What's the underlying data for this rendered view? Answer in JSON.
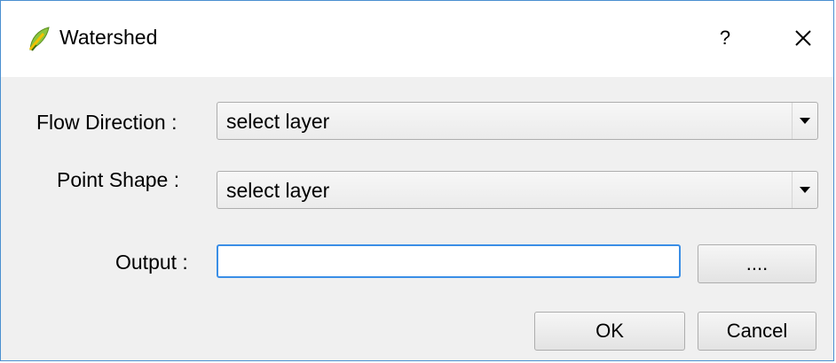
{
  "window": {
    "title": "Watershed",
    "help_label": "?",
    "icon": "qgis-leaf-icon"
  },
  "form": {
    "flow_direction": {
      "label": "Flow Direction :",
      "value": "select layer"
    },
    "point_shape": {
      "label": "Point Shape :",
      "value": "select layer"
    },
    "output": {
      "label": "Output :",
      "value": "",
      "browse_label": "...."
    }
  },
  "buttons": {
    "ok_label": "OK",
    "cancel_label": "Cancel"
  },
  "colors": {
    "focus_border": "#3a8ee6",
    "window_border": "#4a8fd0"
  }
}
